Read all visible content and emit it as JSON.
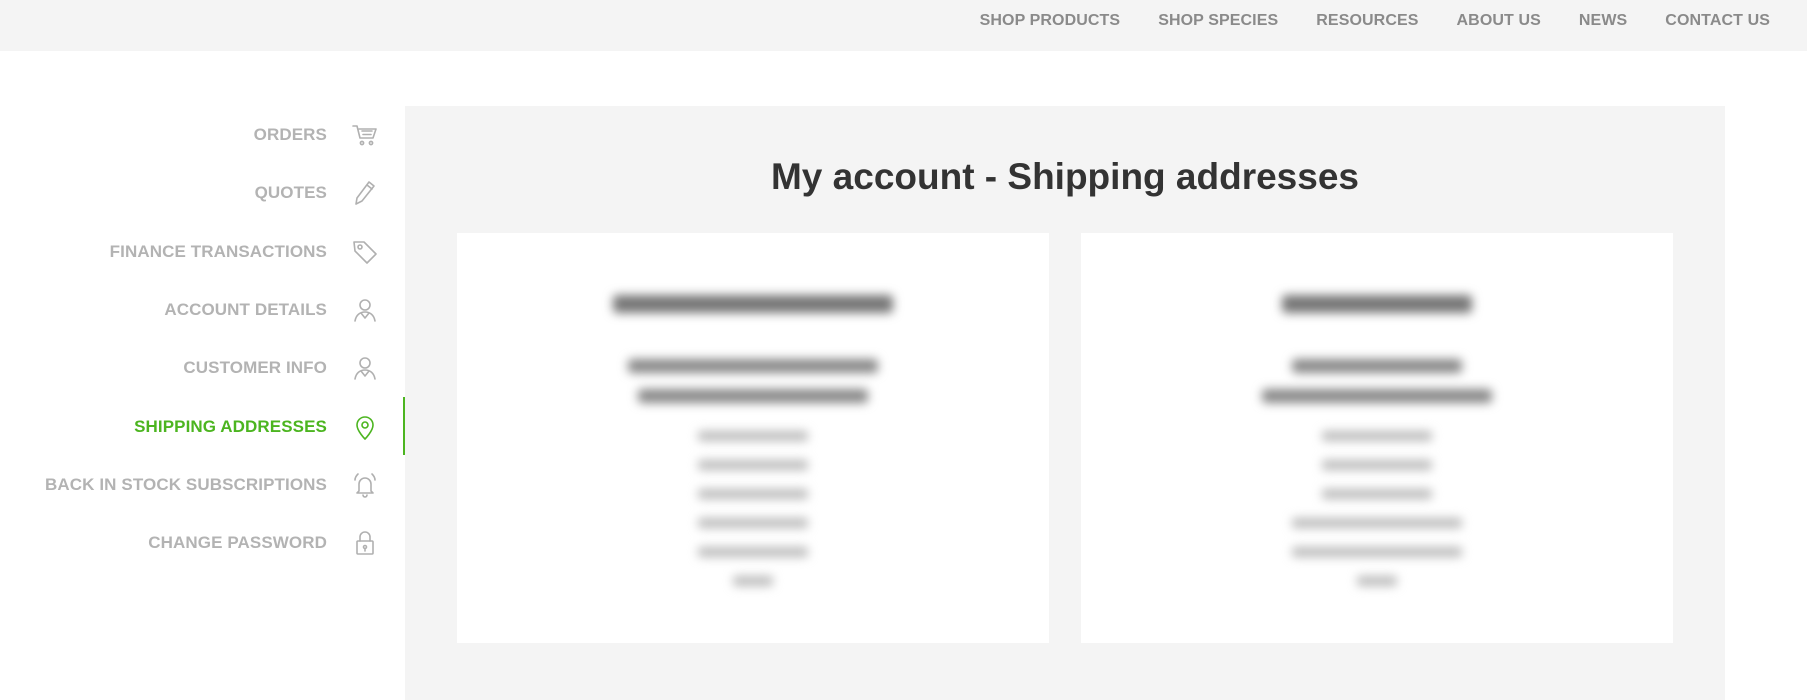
{
  "topnav": [
    {
      "label": "SHOP PRODUCTS",
      "name": "nav-shop-products"
    },
    {
      "label": "SHOP SPECIES",
      "name": "nav-shop-species"
    },
    {
      "label": "RESOURCES",
      "name": "nav-resources"
    },
    {
      "label": "ABOUT US",
      "name": "nav-about-us"
    },
    {
      "label": "NEWS",
      "name": "nav-news"
    },
    {
      "label": "CONTACT US",
      "name": "nav-contact-us"
    }
  ],
  "sidebar": {
    "items": [
      {
        "label": "ORDERS",
        "icon": "cart-icon",
        "active": false
      },
      {
        "label": "QUOTES",
        "icon": "pencil-icon",
        "active": false
      },
      {
        "label": "FINANCE TRANSACTIONS",
        "icon": "tag-icon",
        "active": false
      },
      {
        "label": "ACCOUNT DETAILS",
        "icon": "user-icon",
        "active": false
      },
      {
        "label": "CUSTOMER INFO",
        "icon": "user-icon",
        "active": false
      },
      {
        "label": "SHIPPING ADDRESSES",
        "icon": "location-pin-icon",
        "active": true
      },
      {
        "label": "BACK IN STOCK SUBSCRIPTIONS",
        "icon": "bell-icon",
        "active": false
      },
      {
        "label": "CHANGE PASSWORD",
        "icon": "lock-icon",
        "active": false
      }
    ]
  },
  "main": {
    "title": "My account - Shipping addresses"
  },
  "colors": {
    "accent": "#4cb520",
    "nav_text": "#8a8a8a",
    "sidebar_text": "#b3b3b3",
    "panel_bg": "#f4f4f4"
  }
}
